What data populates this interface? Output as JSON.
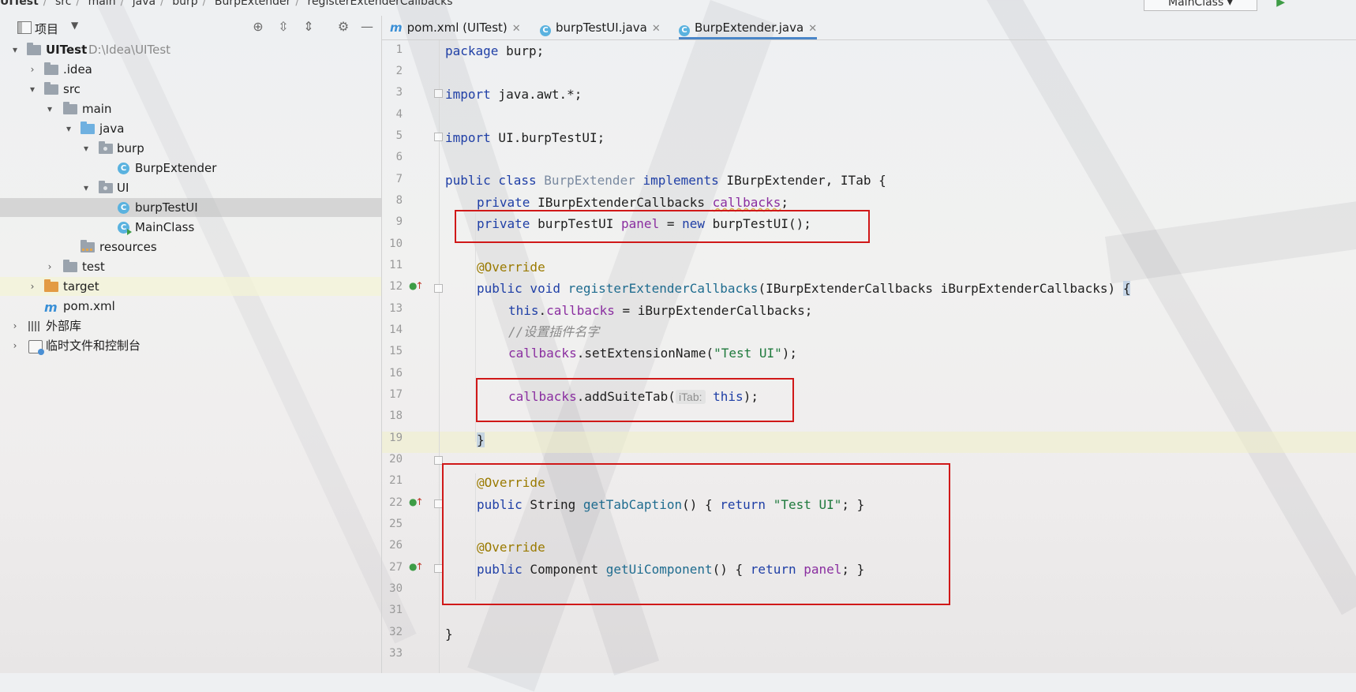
{
  "breadcrumb": {
    "items": [
      "UITest",
      "src",
      "main",
      "java",
      "burp",
      "BurpExtender",
      "registerExtenderCallbacks"
    ],
    "run_config": "MainClass"
  },
  "project_panel": {
    "title": "项目",
    "tree": [
      {
        "label": "UITest",
        "path": "D:\\Idea\\UITest"
      },
      {
        "label": ".idea"
      },
      {
        "label": "src"
      },
      {
        "label": "main"
      },
      {
        "label": "java"
      },
      {
        "label": "burp"
      },
      {
        "label": "BurpExtender"
      },
      {
        "label": "UI"
      },
      {
        "label": "burpTestUI"
      },
      {
        "label": "MainClass"
      },
      {
        "label": "resources"
      },
      {
        "label": "test"
      },
      {
        "label": "target"
      },
      {
        "label": "pom.xml"
      },
      {
        "label": "外部库"
      },
      {
        "label": "临时文件和控制台"
      }
    ]
  },
  "tabs": [
    {
      "label": "pom.xml (UITest)"
    },
    {
      "label": "burpTestUI.java"
    },
    {
      "label": "BurpExtender.java"
    }
  ],
  "line_numbers": [
    "1",
    "2",
    "3",
    "4",
    "5",
    "6",
    "7",
    "8",
    "9",
    "10",
    "11",
    "12",
    "13",
    "14",
    "15",
    "16",
    "17",
    "18",
    "19",
    "20",
    "21",
    "22",
    "25",
    "26",
    "27",
    "30",
    "31",
    "32",
    "33"
  ],
  "code": {
    "l1": [
      "package",
      " burp;"
    ],
    "l3": [
      "import",
      " java.awt.*;"
    ],
    "l5": [
      "import",
      " UI.burpTestUI;"
    ],
    "l7": [
      "public class",
      " ",
      "BurpExtender",
      " ",
      "implements",
      " IBurpExtender, ITab {"
    ],
    "l8": [
      "private",
      " IBurpExtenderCallbacks ",
      "callbacks",
      ";"
    ],
    "l9": [
      "private",
      " burpTestUI ",
      "panel",
      " = ",
      "new",
      " burpTestUI();"
    ],
    "l11": [
      "@Override"
    ],
    "l12": [
      "public void",
      " ",
      "registerExtenderCallbacks",
      "(IBurpExtenderCallbacks iBurpExtenderCallbacks) ",
      "{"
    ],
    "l13": [
      "this",
      ".",
      "callbacks",
      " = iBurpExtenderCallbacks;"
    ],
    "l14": [
      "//设置插件名字"
    ],
    "l15": [
      "callbacks",
      ".setExtensionName(",
      "\"Test UI\"",
      ");"
    ],
    "l17": [
      "callbacks",
      ".addSuiteTab(",
      "iTab:",
      " ",
      "this",
      ");"
    ],
    "l19": [
      "}"
    ],
    "l21": [
      "@Override"
    ],
    "l22": [
      "public",
      " String ",
      "getTabCaption",
      "() ",
      "{ ",
      "return",
      " ",
      "\"Test UI\"",
      "; }"
    ],
    "l26": [
      "@Override"
    ],
    "l27": [
      "public",
      " Component ",
      "getUiComponent",
      "() ",
      "{ ",
      "return",
      " ",
      "panel",
      "; }"
    ],
    "l32": [
      "}"
    ]
  },
  "colors": {
    "keyword": "#1f3fa6",
    "field": "#8a2ea0",
    "string": "#1f7a3d",
    "annotation": "#9a7a00",
    "method": "#1f6c8f",
    "annotation_box": "#d01818",
    "active_tab_underline": "#4a86c8"
  },
  "icons": {
    "project_window": "project-window-icon",
    "locate": "crosshair-icon",
    "expand_all": "expand-all-icon",
    "collapse_all": "collapse-all-icon",
    "settings": "gear-icon",
    "hide": "minimize-icon"
  }
}
